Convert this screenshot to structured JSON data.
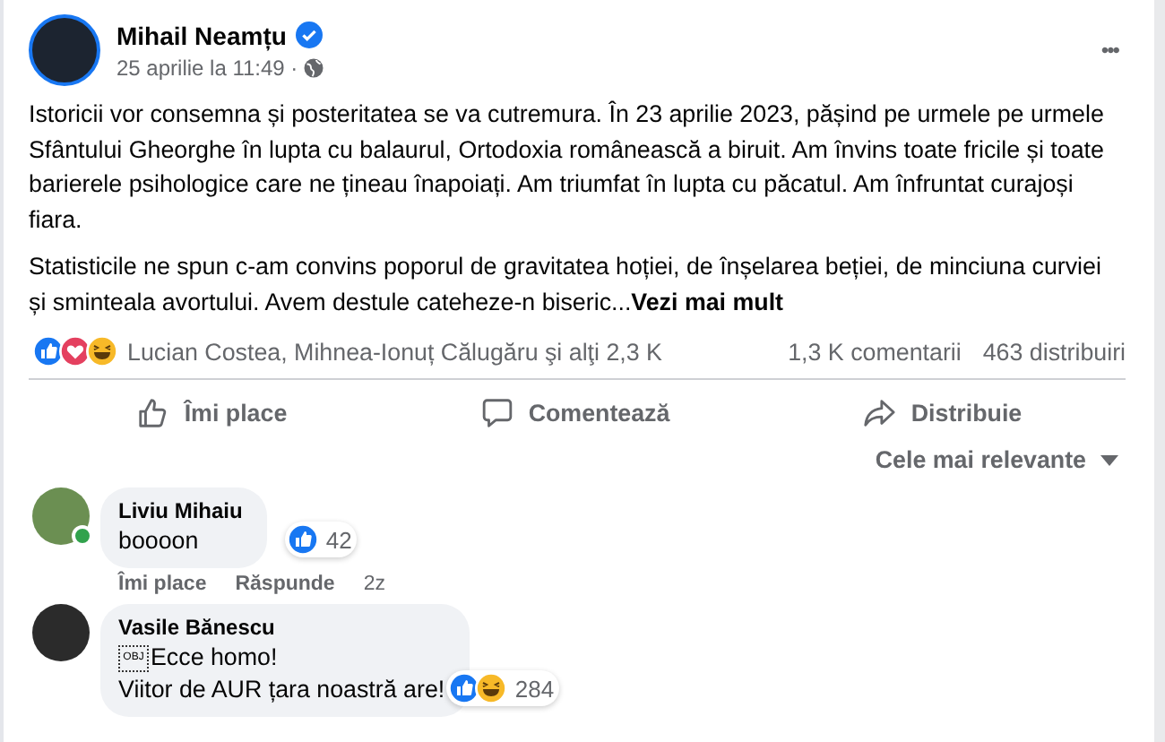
{
  "post": {
    "author": "Mihail Neamțu",
    "time": "25 aprilie la 11:49 ·",
    "menu": "•••",
    "paragraphs": [
      "Istoricii vor consemna și posteritatea se va cutremura. În 23 aprilie 2023, pășind pe urmele pe urmele Sfântului Gheorghe în lupta cu balaurul, Ortodoxia românească a biruit. Am învins toate fricile și toate barierele psihologice care ne țineau înapoiați. Am triumfat în lupta cu păcatul. Am înfruntat curajoși fiara.",
      "Statisticile ne spun c-am convins poporul de gravitatea hoției, de înșelarea beției, de minciuna curviei și sminteala avortului. Avem destule cateheze-n biseric..."
    ],
    "see_more": "Vezi mai mult"
  },
  "summary": {
    "reactions": [
      {
        "kind": "like"
      },
      {
        "kind": "love"
      },
      {
        "kind": "haha"
      }
    ],
    "names": "Lucian Costea, Mihnea-Ionuț Călugăru şi alţi 2,3 K",
    "comments": "1,3 K comentarii",
    "shares": "463 distribuiri"
  },
  "actions": [
    {
      "kind": "like",
      "label": "Îmi place"
    },
    {
      "kind": "comment",
      "label": "Comentează"
    },
    {
      "kind": "share",
      "label": "Distribuie"
    }
  ],
  "sort": "Cele mai relevante",
  "comments": [
    {
      "name": "Liviu Mihaiu",
      "online": true,
      "lines": [
        "boooon"
      ],
      "reactions": [
        {
          "kind": "like"
        }
      ],
      "count": "42",
      "actions": [
        "Îmi place",
        "Răspunde"
      ],
      "time": "2z"
    },
    {
      "name": "Vasile Bănescu",
      "online": false,
      "lines": [
        "Ecce homo!",
        "Viitor de AUR țara noastră are!"
      ],
      "object_label": "OBJ",
      "reactions": [
        {
          "kind": "like"
        },
        {
          "kind": "haha"
        }
      ],
      "count": "284"
    }
  ]
}
